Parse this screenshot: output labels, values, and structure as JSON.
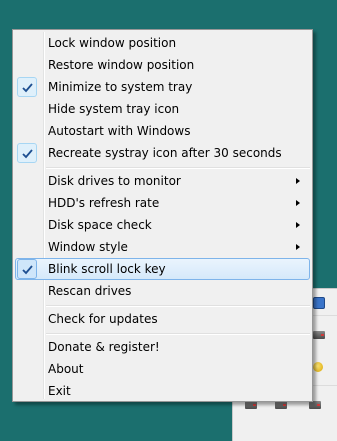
{
  "menu": {
    "items": [
      {
        "label": "Lock window position",
        "checked": false,
        "submenu": false
      },
      {
        "label": "Restore window position",
        "checked": false,
        "submenu": false
      },
      {
        "label": "Minimize to system tray",
        "checked": true,
        "submenu": false
      },
      {
        "label": "Hide system tray icon",
        "checked": false,
        "submenu": false
      },
      {
        "label": "Autostart with Windows",
        "checked": false,
        "submenu": false
      },
      {
        "label": "Recreate systray icon after 30 seconds",
        "checked": true,
        "submenu": false
      },
      {
        "label": "Disk drives to monitor",
        "checked": false,
        "submenu": true
      },
      {
        "label": "HDD's refresh rate",
        "checked": false,
        "submenu": true
      },
      {
        "label": "Disk space check",
        "checked": false,
        "submenu": true
      },
      {
        "label": "Window style",
        "checked": false,
        "submenu": true
      },
      {
        "label": "Blink scroll lock key",
        "checked": true,
        "submenu": false,
        "highlighted": true
      },
      {
        "label": "Rescan drives",
        "checked": false,
        "submenu": false
      },
      {
        "label": "Check for updates",
        "checked": false,
        "submenu": false
      },
      {
        "label": "Donate & register!",
        "checked": false,
        "submenu": false
      },
      {
        "label": "About",
        "checked": false,
        "submenu": false
      },
      {
        "label": "Exit",
        "checked": false,
        "submenu": false
      }
    ]
  },
  "colors": {
    "desktop": "#1b6f6e",
    "menu_bg": "#f0f0f0",
    "highlight_border": "#7eb4ea"
  },
  "icons": [
    "checkmark-icon",
    "submenu-arrow-icon",
    "drive-icon"
  ]
}
